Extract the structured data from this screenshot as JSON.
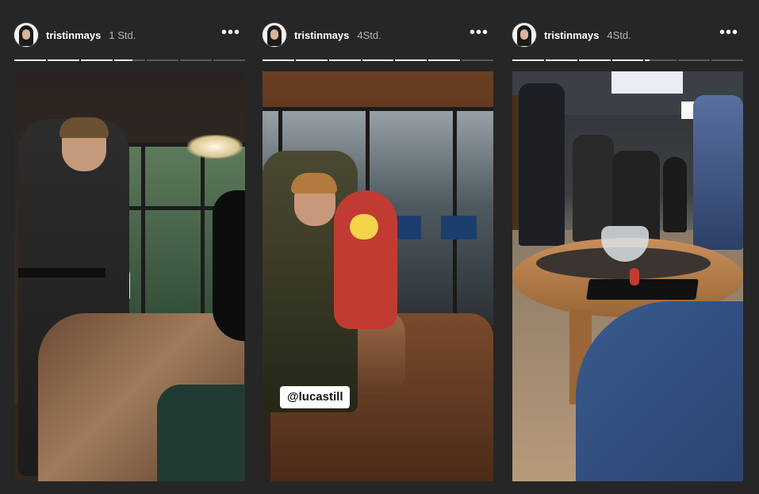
{
  "stories": [
    {
      "username": "tristinmays",
      "time": "1 Std.",
      "more_icon": "more-horizontal-icon",
      "segments": 7,
      "progress": [
        1,
        1,
        1,
        0.6,
        0,
        0,
        0
      ]
    },
    {
      "username": "tristinmays",
      "time": "4Std.",
      "more_icon": "more-horizontal-icon",
      "segments": 7,
      "progress": [
        1,
        1,
        1,
        1,
        1,
        1,
        0
      ],
      "mention": "@lucastill"
    },
    {
      "username": "tristinmays",
      "time": "4Std.",
      "more_icon": "more-horizontal-icon",
      "segments": 7,
      "progress": [
        1,
        1,
        1,
        1,
        0.15,
        0,
        0
      ]
    }
  ]
}
